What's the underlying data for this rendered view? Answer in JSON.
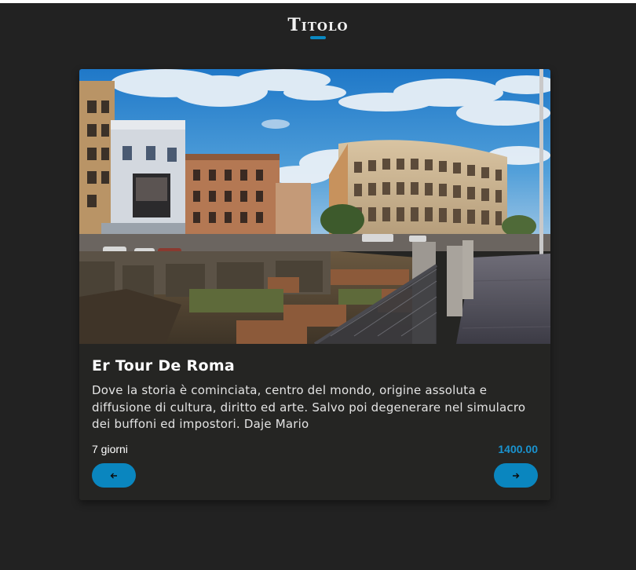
{
  "page": {
    "title": "Titolo",
    "accent_color": "#0a88c2"
  },
  "card": {
    "image": {
      "alt": "Colosseo",
      "icon": "colosseum-photo"
    },
    "title": "Er Tour De Roma",
    "description": "Dove la storia è cominciata, centro del mondo, origine assoluta e diffusione di cultura, diritto ed arte. Salvo poi degenerare nel simulacro dei buffoni ed impostori. Daje Mario",
    "duration": "7 giorni",
    "price": "1400.00",
    "price_color": "#1a93cf",
    "buttons": {
      "prev_icon": "arrow-left-icon",
      "next_icon": "arrow-right-icon",
      "color": "#0a86bf"
    }
  }
}
